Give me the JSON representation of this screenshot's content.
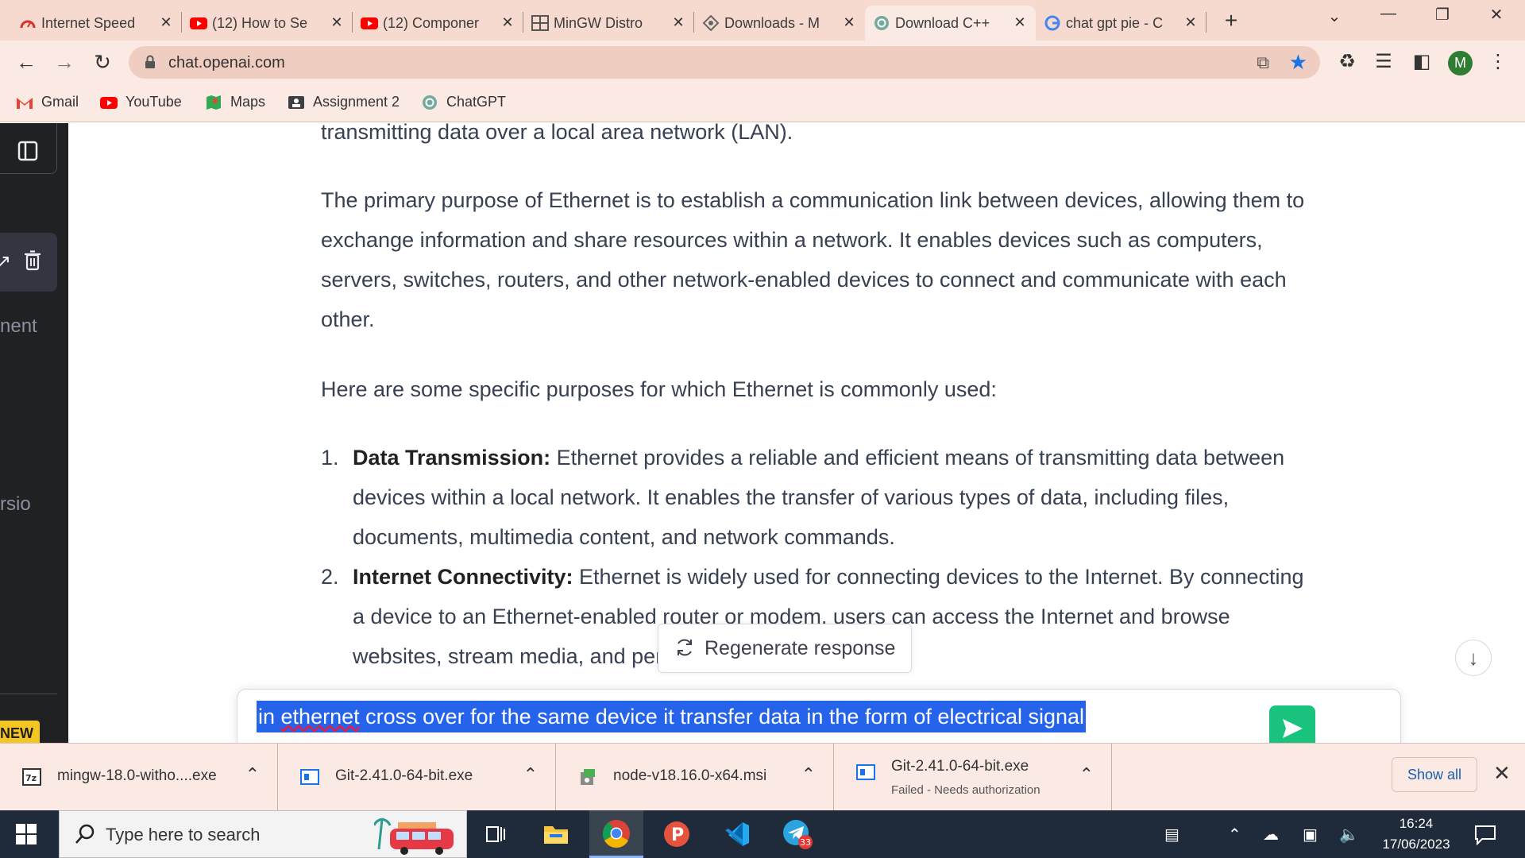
{
  "browser": {
    "tabs": [
      {
        "title": "Internet Speed",
        "icon": "speedometer-icon"
      },
      {
        "title": "(12) How to Se",
        "icon": "youtube-icon"
      },
      {
        "title": "(12) Componer",
        "icon": "youtube-icon"
      },
      {
        "title": "MinGW Distro",
        "icon": "page-grid-icon"
      },
      {
        "title": "Downloads - M",
        "icon": "sourceforge-icon"
      },
      {
        "title": "Download C++",
        "icon": "chatgpt-icon",
        "active": true
      },
      {
        "title": "chat gpt pie - C",
        "icon": "google-icon"
      }
    ],
    "tab_close_glyph": "✕",
    "new_tab_glyph": "+",
    "address": "chat.openai.com",
    "profile_initial": "M",
    "bookmarks": [
      {
        "label": "Gmail",
        "icon": "gmail-icon"
      },
      {
        "label": "YouTube",
        "icon": "youtube-icon"
      },
      {
        "label": "Maps",
        "icon": "maps-icon"
      },
      {
        "label": "Assignment 2",
        "icon": "classroom-icon"
      },
      {
        "label": "ChatGPT",
        "icon": "chatgpt-icon"
      }
    ]
  },
  "sidebar": {
    "partial_texts": [
      "nent",
      "rsio"
    ],
    "new_badge": "NEW"
  },
  "chat": {
    "lines_top": "transmitting data over a local area network (LAN).",
    "para1": "The primary purpose of Ethernet is to establish a communication link between devices, allowing them to exchange information and share resources within a network. It enables devices such as computers, servers, switches, routers, and other network-enabled devices to connect and communicate with each other.",
    "para2": "Here are some specific purposes for which Ethernet is commonly used:",
    "list": [
      {
        "num": "1.",
        "title": "Data Transmission:",
        "text": " Ethernet provides a reliable and efficient means of transmitting data between devices within a local network. It enables the transfer of various types of data, including files, documents, multimedia content, and network commands."
      },
      {
        "num": "2.",
        "title": "Internet Connectivity:",
        "text": " Ethernet is widely used for connecting devices to the Internet. By connecting a device to an Ethernet-enabled router or modem, users can access the Internet and browse websites, stream media, and perform other"
      }
    ],
    "regenerate_label": "Regenerate response",
    "input_prefix": "in ",
    "input_misspelled": "ethernet",
    "input_rest": " cross over for the same device it transfer data in the form of electrical signal"
  },
  "downloads": {
    "items": [
      {
        "name": "mingw-18.0-witho....exe",
        "status": "",
        "icon": "archive-icon"
      },
      {
        "name": "Git-2.41.0-64-bit.exe",
        "status": "",
        "icon": "installer-icon"
      },
      {
        "name": "node-v18.16.0-x64.msi",
        "status": "",
        "icon": "msi-package-icon"
      },
      {
        "name": "Git-2.41.0-64-bit.exe",
        "status": "Failed - Needs authorization",
        "icon": "installer-icon"
      }
    ],
    "show_all": "Show all"
  },
  "taskbar": {
    "search_placeholder": "Type here to search",
    "telegram_badge": "33",
    "time": "16:24",
    "date": "17/06/2023"
  },
  "colors": {
    "tab_bg": "#f6d9cf",
    "toolbar_bg": "#fbe9e3",
    "sidebar_bg": "#202123",
    "selection": "#2563eb",
    "send_button": "#19c37d",
    "taskbar_bg": "#1f2b3a"
  }
}
